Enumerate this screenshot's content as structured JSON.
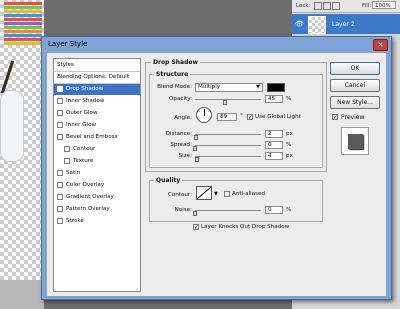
{
  "layers_panel": {
    "lock_label": "Lock:",
    "fill_label": "Fill:",
    "fill_value": "100%",
    "layer_name": "Layer 2"
  },
  "dialog": {
    "title": "Layer Style",
    "close_glyph": "✕",
    "style_list": {
      "header": "Styles",
      "items": [
        {
          "label": "Blending Options: Default",
          "type": "plain"
        },
        {
          "label": "Drop Shadow",
          "type": "check",
          "checked": true,
          "selected": true
        },
        {
          "label": "Inner Shadow",
          "type": "check"
        },
        {
          "label": "Outer Glow",
          "type": "check"
        },
        {
          "label": "Inner Glow",
          "type": "check"
        },
        {
          "label": "Bevel and Emboss",
          "type": "check"
        },
        {
          "label": "Contour",
          "type": "check",
          "indent": true
        },
        {
          "label": "Texture",
          "type": "check",
          "indent": true
        },
        {
          "label": "Satin",
          "type": "check"
        },
        {
          "label": "Color Overlay",
          "type": "check"
        },
        {
          "label": "Gradient Overlay",
          "type": "check"
        },
        {
          "label": "Pattern Overlay",
          "type": "check"
        },
        {
          "label": "Stroke",
          "type": "check"
        }
      ]
    },
    "drop_shadow": {
      "title": "Drop Shadow",
      "structure": {
        "title": "Structure",
        "blend_mode_label": "Blend Mode:",
        "blend_mode_value": "Multiply",
        "shadow_color": "#000000",
        "opacity_label": "Opacity:",
        "opacity_value": "45",
        "opacity_unit": "%",
        "opacity_fraction": 0.45,
        "angle_label": "Angle:",
        "angle_value": "89",
        "angle_unit": "°",
        "use_global_light_label": "Use Global Light",
        "use_global_light_checked": true,
        "distance_label": "Distance:",
        "distance_value": "2",
        "distance_unit": "px",
        "distance_fraction": 0.02,
        "spread_label": "Spread:",
        "spread_value": "0",
        "spread_unit": "%",
        "spread_fraction": 0.0,
        "size_label": "Size:",
        "size_value": "4",
        "size_unit": "px",
        "size_fraction": 0.03
      },
      "quality": {
        "title": "Quality",
        "contour_label": "Contour:",
        "anti_aliased_label": "Anti-aliased",
        "noise_label": "Noise:",
        "noise_value": "0",
        "noise_unit": "%",
        "noise_fraction": 0.0
      },
      "knockout_label": "Layer Knocks Out Drop Shadow",
      "knockout_checked": true
    },
    "buttons": {
      "ok": "OK",
      "cancel": "Cancel",
      "new_style": "New Style...",
      "preview_label": "Preview",
      "preview_checked": true
    }
  },
  "colors": {
    "selection": "#3b72c6",
    "title_bar": "#7ea3d4",
    "close_button": "#c0443a"
  }
}
